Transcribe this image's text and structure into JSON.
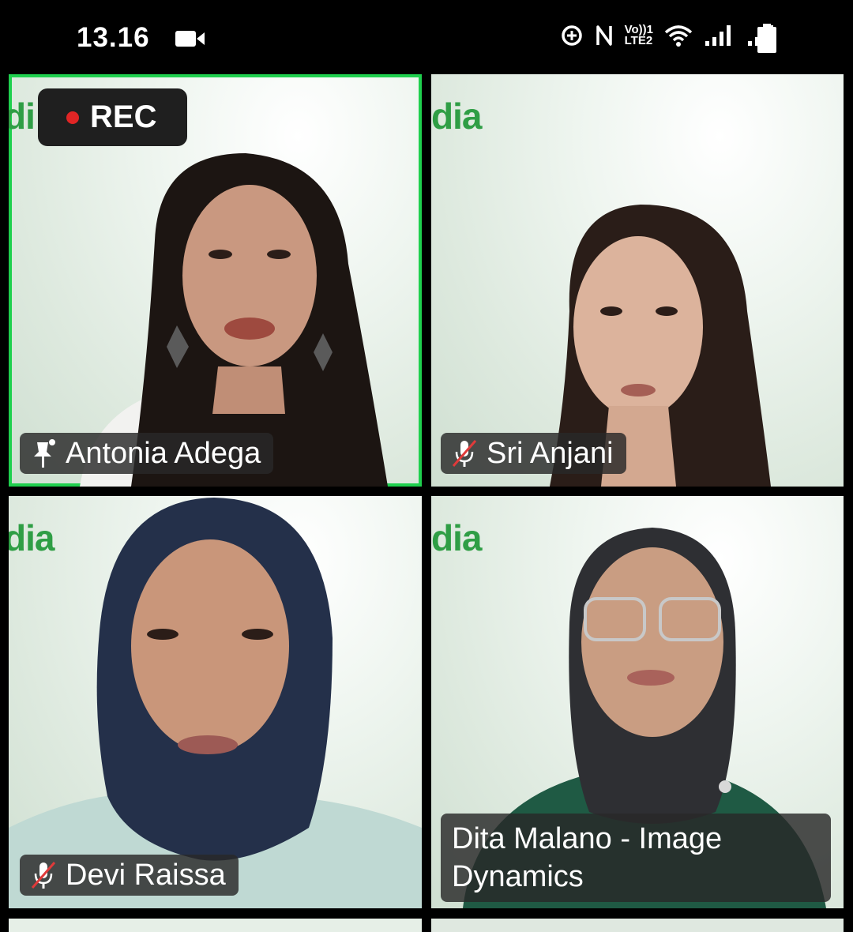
{
  "status_bar": {
    "time": "13.16",
    "icons": [
      "video-camera-icon",
      "data-saver-icon",
      "nfc-icon",
      "volte-icon",
      "wifi-icon",
      "signal-icon",
      "signal-icon",
      "battery-icon"
    ],
    "volte_text_top": "Vo))1",
    "volte_text_bottom": "LTE2"
  },
  "recording_badge": {
    "label": "REC",
    "dot_color": "#e02525"
  },
  "accent_color": "#1fd04e",
  "participants": [
    {
      "name": "Antonia Adega",
      "status_icon": "pin-icon",
      "active_speaker": true
    },
    {
      "name": "Sri Anjani",
      "status_icon": "mic-muted-icon",
      "active_speaker": false
    },
    {
      "name": "Devi Raissa",
      "status_icon": "mic-muted-icon",
      "active_speaker": false
    },
    {
      "name_line1": "Dita Malano - Image",
      "name_line2": "Dynamics",
      "status_icon": "none",
      "active_speaker": false
    }
  ],
  "background_brand": [
    "di",
    "dia",
    "dia",
    "dia"
  ]
}
